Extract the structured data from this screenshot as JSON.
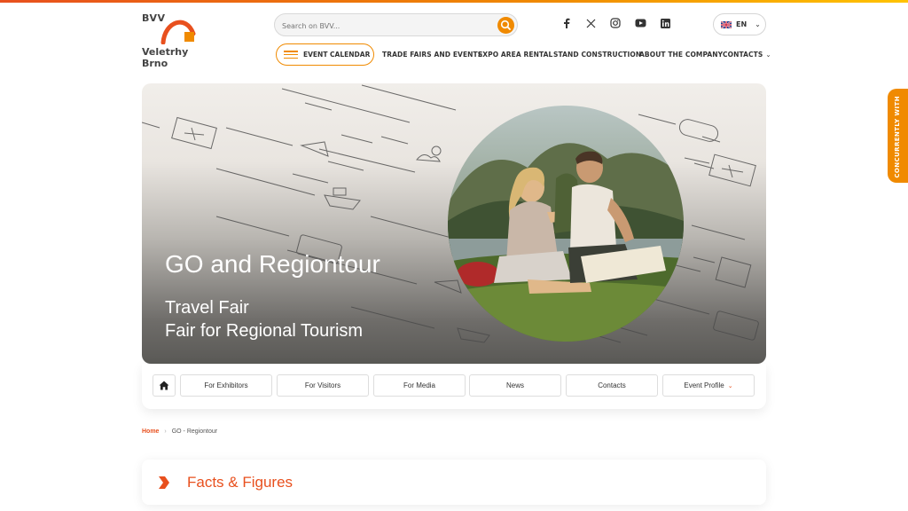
{
  "logo": {
    "top_text": "BVV",
    "line1": "Veletrhy",
    "line2": "Brno"
  },
  "search": {
    "placeholder": "Search on BVV..."
  },
  "social": [
    "facebook-icon",
    "x-icon",
    "instagram-icon",
    "youtube-icon",
    "linkedin-icon"
  ],
  "language": {
    "code": "EN"
  },
  "nav": {
    "calendar": "EVENT CALENDAR",
    "items": [
      "TRADE FAIRS AND EVENTS",
      "EXPO AREA RENTAL",
      "STAND CONSTRUCTION",
      "ABOUT THE COMPANY",
      "CONTACTS"
    ]
  },
  "hero": {
    "title": "GO and Regiontour",
    "subtitle1": "Travel Fair",
    "subtitle2": "Fair for Regional Tourism"
  },
  "subnav": {
    "tabs": [
      "For Exhibitors",
      "For Visitors",
      "For Media",
      "News",
      "Contacts",
      "Event Profile"
    ]
  },
  "breadcrumb": {
    "home": "Home",
    "current": "GO - Regiontour"
  },
  "section": {
    "title": "Facts & Figures"
  },
  "side_tab": {
    "label": "CONCURRENTLY WITH"
  },
  "colors": {
    "accent": "#e8501e",
    "orange": "#f08a00"
  }
}
